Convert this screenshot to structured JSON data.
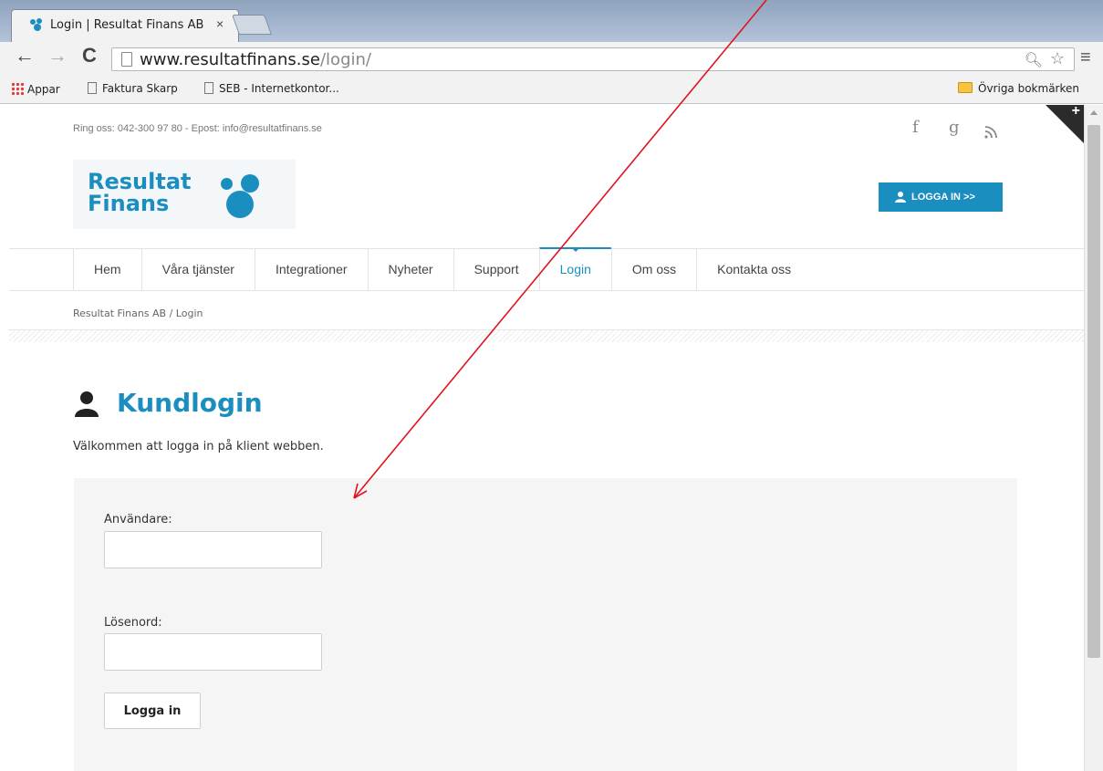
{
  "browser": {
    "tab_title": "Login | Resultat Finans AB",
    "tab_close": "×",
    "url_host": "www.resultatfinans.se",
    "url_path": "/login/",
    "bookmarks": {
      "apps": "Appar",
      "items": [
        "Faktura Skarp",
        "SEB - Internetkontor..."
      ],
      "other": "Övriga bokmärken"
    }
  },
  "topbar": {
    "contact": "Ring oss: 042-300 97 80 - Epost: info@resultatfinans.se",
    "social": [
      "facebook-icon",
      "google-plus-icon",
      "rss-icon"
    ]
  },
  "logo": {
    "line1": "Resultat",
    "line2": "Finans"
  },
  "header": {
    "login_button": "LOGGA IN >>"
  },
  "nav": {
    "items": [
      "Hem",
      "Våra tjänster",
      "Integrationer",
      "Nyheter",
      "Support",
      "Login",
      "Om oss",
      "Kontakta oss"
    ],
    "active": "Login"
  },
  "breadcrumb": "Resultat Finans AB / Login",
  "main": {
    "title": "Kundlogin",
    "intro": "Välkommen att logga in på klient webben.",
    "form": {
      "user_label": "Användare:",
      "user_value": "",
      "password_label": "Lösenord:",
      "password_value": "",
      "submit": "Logga in"
    }
  },
  "colors": {
    "accent": "#1b8ec0",
    "annotation": "#e0141e"
  }
}
